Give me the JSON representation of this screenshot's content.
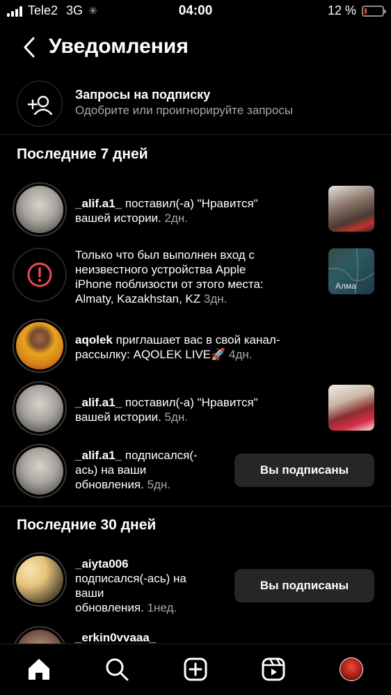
{
  "status_bar": {
    "carrier": "Tele2",
    "network": "3G",
    "time": "04:00",
    "battery_text": "12 %",
    "battery_level": 0.12
  },
  "header": {
    "title": "Уведомления"
  },
  "requests": {
    "title": "Запросы на подписку",
    "subtitle": "Одобрите или проигнорируйте запросы"
  },
  "sections": {
    "last7": "Последние 7 дней",
    "last30": "Последние 30 дней"
  },
  "items": [
    {
      "user": "_alif.a1_",
      "line1": " поставил(-а) \"Нравится\"",
      "line2": "вашей истории.",
      "time": " 2дн."
    },
    {
      "line1": "Только что был выполнен вход с",
      "line2": "неизвестного устройства Apple",
      "line3": "iPhone поблизости от этого места:",
      "line4": "Almaty, Kazakhstan, KZ",
      "time": " 3дн.",
      "thumb_label": "Алма"
    },
    {
      "user": "aqolek",
      "line1": " приглашает вас в свой канал-",
      "line2": "рассылку: AQOLEK LIVE🚀",
      "time": " 4дн."
    },
    {
      "user": "_alif.a1_",
      "line1": " поставил(-а) \"Нравится\"",
      "line2": "вашей истории.",
      "time": " 5дн."
    },
    {
      "user": "_alif.a1_",
      "line1": " подписался(-",
      "line2": "ась) на ваши",
      "line3": "обновления.",
      "time": " 5дн.",
      "button": "Вы подписаны"
    },
    {
      "user": "_aiyta006",
      "line1": "подписался(-ась) на",
      "line2": "ваши",
      "line3": "обновления.",
      "time": " 1нед.",
      "button": "Вы подписаны"
    },
    {
      "user": "_erkin0vvaaa_"
    }
  ]
}
